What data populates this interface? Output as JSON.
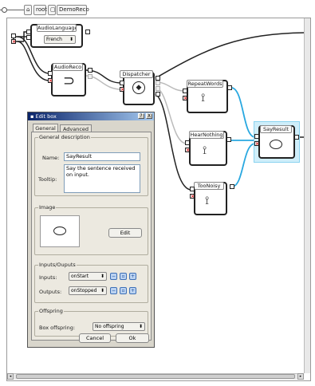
{
  "breadcrumb": {
    "items": [
      "root",
      "DemoReco"
    ]
  },
  "boxes": {
    "audio_language": {
      "title": "AudioLanguage",
      "value": "French"
    },
    "audio_reco": {
      "title": "AudioReco"
    },
    "dispatcher": {
      "title": "Dispatcher"
    },
    "repeat_words": {
      "title": "RepeatWords"
    },
    "hear_nothing": {
      "title": "HearNothing"
    },
    "too_noisy": {
      "title": "TooNoisy"
    },
    "say_result": {
      "title": "SayResult"
    }
  },
  "dialog": {
    "title": "Edit box",
    "title_buttons": [
      "?",
      "X"
    ],
    "tabs": [
      "General",
      "Advanced"
    ],
    "general_description_label": "General description",
    "name_label": "Name:",
    "name_value": "SayResult",
    "tooltip_label": "Tooltip:",
    "tooltip_value": "Say the sentence received on input.",
    "image_label": "Image",
    "edit_label": "Edit",
    "io_label": "Inputs/Ouputs",
    "inputs_label": "Inputs:",
    "inputs_value": "onStart",
    "outputs_label": "Outputs:",
    "outputs_value": "onStopped",
    "offspring_label": "Offspring",
    "box_offspring_label": "Box offspring:",
    "box_offspring_value": "No offspring",
    "cancel_label": "Cancel",
    "ok_label": "Ok"
  },
  "colors": {
    "selection": "#29a8e0",
    "accent_red": "#c00000",
    "title_bar": "#0a246a"
  }
}
